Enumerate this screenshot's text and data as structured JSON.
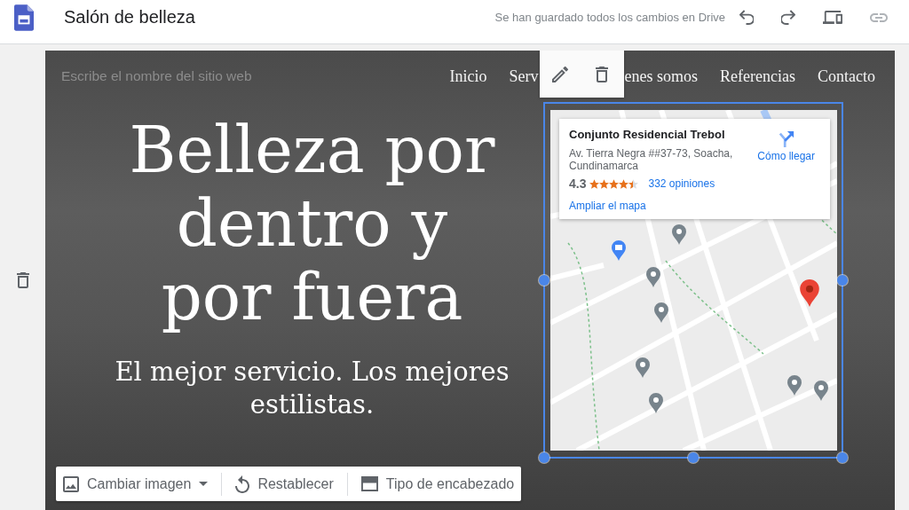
{
  "app_bar": {
    "title": "Salón de belleza",
    "save_status": "Se han guardado todos los cambios en Drive",
    "link_disabled": true
  },
  "header": {
    "site_name": {
      "placeholder": "Escribe el nombre del sitio web"
    },
    "nav": [
      "Inicio",
      "Serv",
      "enes somos",
      "Referencias",
      "Contacto"
    ],
    "title": "Belleza por dentro y por fuera",
    "subtitle": "El mejor servicio. Los mejores estilistas."
  },
  "map": {
    "place": {
      "name": "Conjunto Residencial Trebol",
      "address": "Av. Tierra Negra ##37-73, Soacha, Cundinamarca",
      "rating": "4.3",
      "stars": 4.5,
      "reviews": "332 opiniones",
      "larger_map": "Ampliar el mapa",
      "directions": "Cómo llegar"
    }
  },
  "header_toolbar": [
    {
      "kind": "image-menu",
      "label": "Cambiar imagen"
    },
    {
      "kind": "reset",
      "label": "Restablecer"
    },
    {
      "kind": "layout",
      "label": "Tipo de encabezado"
    }
  ]
}
